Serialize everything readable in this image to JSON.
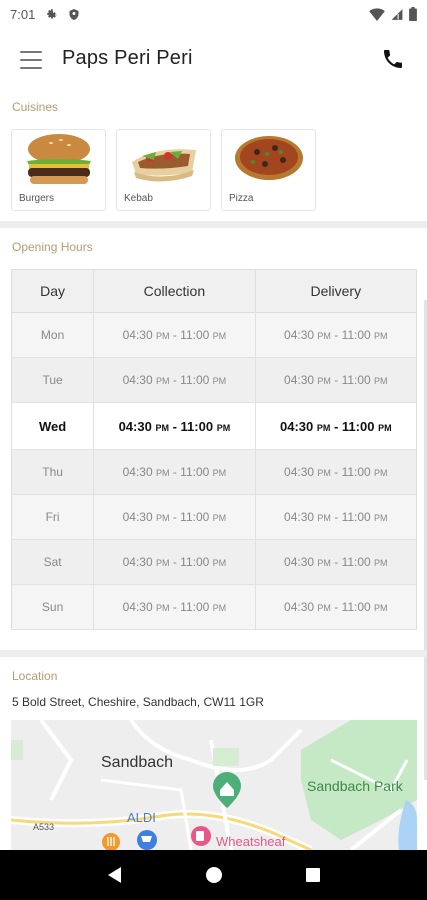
{
  "status_bar": {
    "time": "7:01",
    "icons": [
      "gear-icon",
      "shield-icon",
      "wifi-icon",
      "signal-icon",
      "battery-icon"
    ]
  },
  "app_bar": {
    "title": "Paps Peri Peri",
    "menu_icon": "hamburger-menu-icon",
    "call_icon": "phone-icon"
  },
  "cuisines": {
    "label": "Cuisines",
    "items": [
      {
        "label": "Burgers",
        "icon": "burger-image"
      },
      {
        "label": "Kebab",
        "icon": "kebab-image"
      },
      {
        "label": "Pizza",
        "icon": "pizza-image"
      }
    ]
  },
  "opening_hours": {
    "label": "Opening Hours",
    "headers": {
      "day": "Day",
      "collection": "Collection",
      "delivery": "Delivery"
    },
    "rows": [
      {
        "day": "Mon",
        "collection": {
          "open": "04:30",
          "open_ampm": "PM",
          "close": "11:00",
          "close_ampm": "PM"
        },
        "delivery": {
          "open": "04:30",
          "open_ampm": "PM",
          "close": "11:00",
          "close_ampm": "PM"
        }
      },
      {
        "day": "Tue",
        "collection": {
          "open": "04:30",
          "open_ampm": "PM",
          "close": "11:00",
          "close_ampm": "PM"
        },
        "delivery": {
          "open": "04:30",
          "open_ampm": "PM",
          "close": "11:00",
          "close_ampm": "PM"
        }
      },
      {
        "day": "Wed",
        "collection": {
          "open": "04:30",
          "open_ampm": "PM",
          "close": "11:00",
          "close_ampm": "PM"
        },
        "delivery": {
          "open": "04:30",
          "open_ampm": "PM",
          "close": "11:00",
          "close_ampm": "PM"
        }
      },
      {
        "day": "Thu",
        "collection": {
          "open": "04:30",
          "open_ampm": "PM",
          "close": "11:00",
          "close_ampm": "PM"
        },
        "delivery": {
          "open": "04:30",
          "open_ampm": "PM",
          "close": "11:00",
          "close_ampm": "PM"
        }
      },
      {
        "day": "Fri",
        "collection": {
          "open": "04:30",
          "open_ampm": "PM",
          "close": "11:00",
          "close_ampm": "PM"
        },
        "delivery": {
          "open": "04:30",
          "open_ampm": "PM",
          "close": "11:00",
          "close_ampm": "PM"
        }
      },
      {
        "day": "Sat",
        "collection": {
          "open": "04:30",
          "open_ampm": "PM",
          "close": "11:00",
          "close_ampm": "PM"
        },
        "delivery": {
          "open": "04:30",
          "open_ampm": "PM",
          "close": "11:00",
          "close_ampm": "PM"
        }
      },
      {
        "day": "Sun",
        "collection": {
          "open": "04:30",
          "open_ampm": "PM",
          "close": "11:00",
          "close_ampm": "PM"
        },
        "delivery": {
          "open": "04:30",
          "open_ampm": "PM",
          "close": "11:00",
          "close_ampm": "PM"
        }
      }
    ],
    "highlighted_day": "Wed"
  },
  "location": {
    "label": "Location",
    "address": "5 Bold Street, Cheshire, Sandbach, CW11 1GR",
    "map": {
      "labels": [
        "Sandbach",
        "Sandbach Park",
        "ALDI",
        "Wheatsheaf",
        "A533"
      ],
      "pin_icon": "home-pin-icon",
      "cart_icon": "shopping-cart-icon",
      "food_icon": "restaurant-icon",
      "pub_icon": "beer-icon"
    }
  },
  "nav_bar": {
    "icons": [
      "back-icon",
      "home-icon",
      "recents-icon"
    ]
  },
  "colors": {
    "section_label": "#b49b72",
    "map_park": "#c5e8c5",
    "map_water": "#aad3f5",
    "pin": "#4caf78",
    "pub_pin": "#e8568a"
  }
}
